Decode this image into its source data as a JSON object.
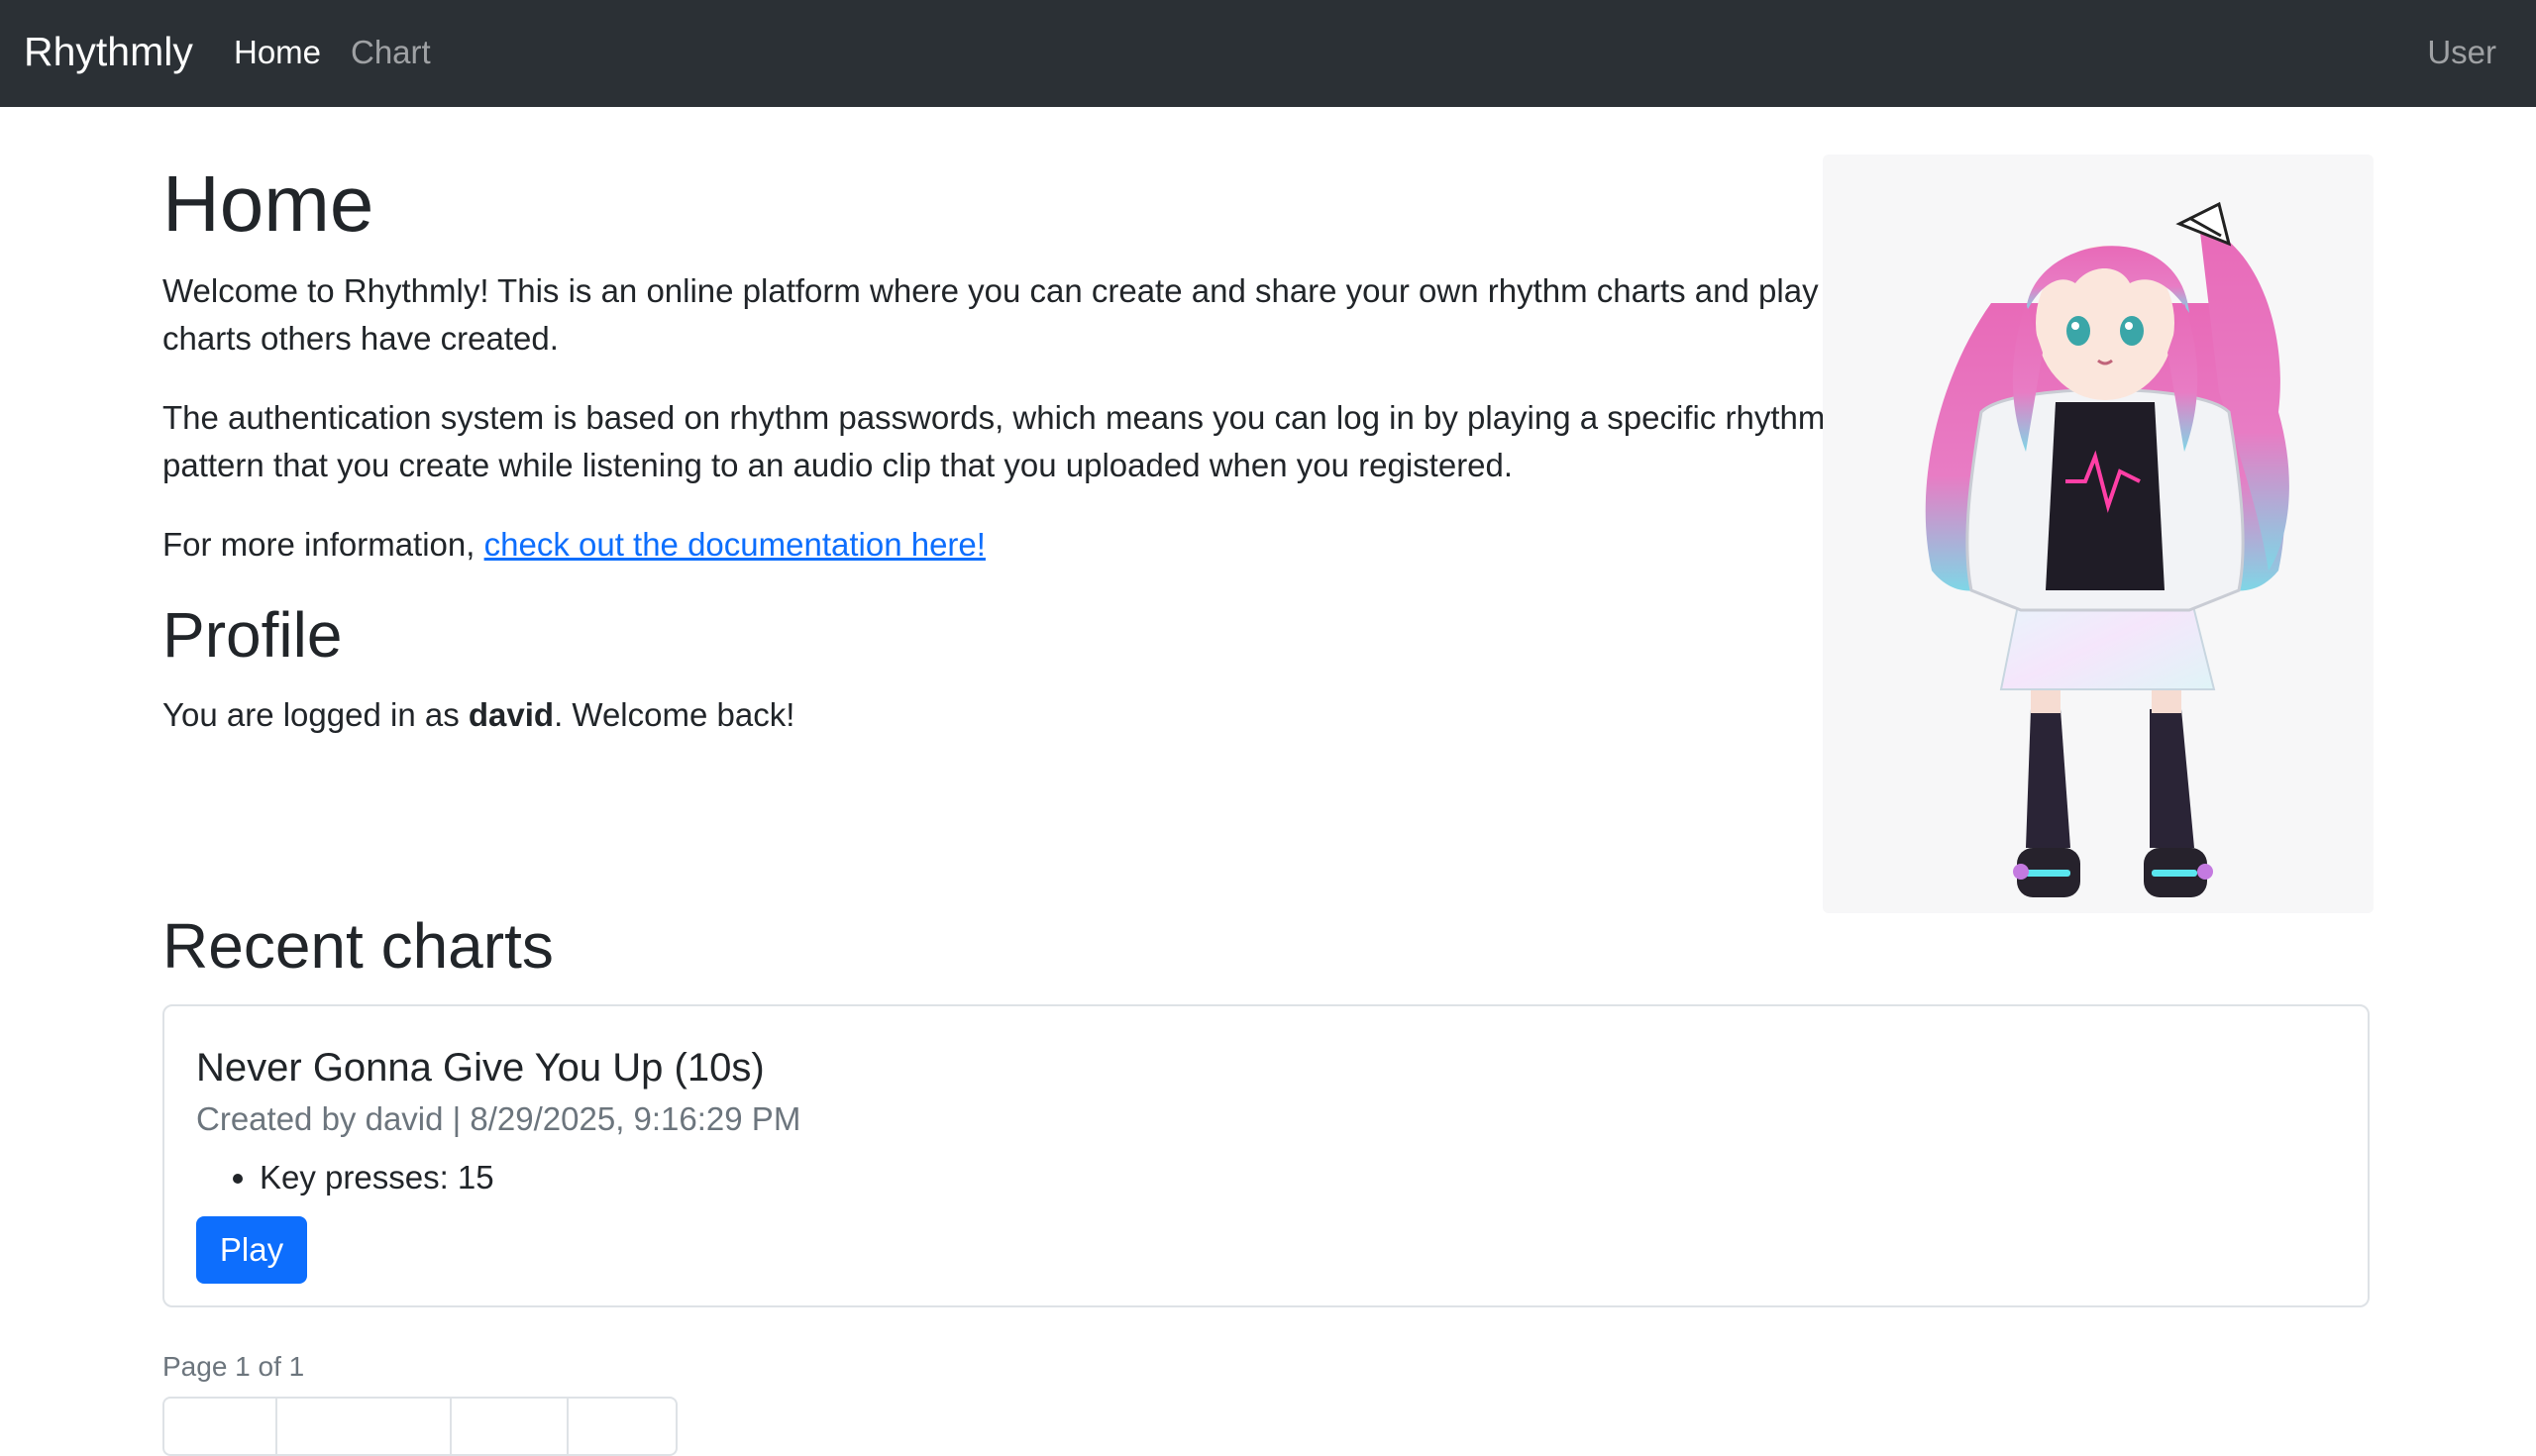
{
  "navbar": {
    "brand": "Rhythmly",
    "links": [
      "Home",
      "Chart"
    ],
    "user": "User"
  },
  "home": {
    "title": "Home",
    "intro": "Welcome to Rhythmly! This is an online platform where you can create and share your own rhythm charts and play charts others have created.",
    "auth": "The authentication system is based on rhythm passwords, which means you can log in by playing a specific rhythm pattern that you create while listening to an audio clip that you uploaded when you registered.",
    "more_info_prefix": "For more information, ",
    "doc_link": "check out the documentation here!"
  },
  "profile": {
    "title": "Profile",
    "prefix": "You are logged in as ",
    "username": "david",
    "suffix": ". Welcome back!"
  },
  "recent": {
    "title": "Recent charts",
    "charts": [
      {
        "title": "Never Gonna Give You Up (10s)",
        "subtitle": "Created by david | 8/29/2025, 9:16:29 PM",
        "details": [
          "Key presses: 15"
        ],
        "play_label": "Play"
      }
    ],
    "page_info": "Page 1 of 1"
  },
  "colors": {
    "navbar_bg": "#2b3035",
    "primary": "#0d6efd",
    "hair_pink": "#e86ab8",
    "hair_cyan": "#7fd6e6"
  }
}
